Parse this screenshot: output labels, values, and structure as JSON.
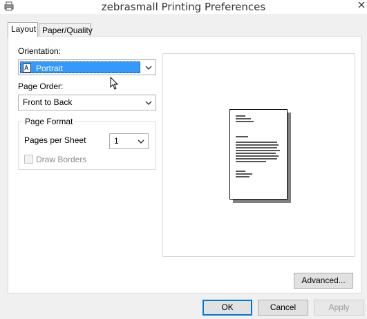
{
  "window": {
    "title": "zebrasmall Printing Preferences"
  },
  "tabs": [
    {
      "label": "Layout",
      "active": true
    },
    {
      "label": "Paper/Quality",
      "active": false
    }
  ],
  "layout": {
    "orientation": {
      "label": "Orientation:",
      "value": "Portrait",
      "icon": "portrait-page-icon"
    },
    "page_order": {
      "label": "Page Order:",
      "value": "Front to Back"
    },
    "page_format": {
      "legend": "Page Format",
      "pages_per_sheet": {
        "label": "Pages per Sheet",
        "value": "1"
      },
      "draw_borders": {
        "label": "Draw Borders",
        "checked": false,
        "enabled": false
      }
    },
    "advanced_label": "Advanced..."
  },
  "footer": {
    "ok_label": "OK",
    "cancel_label": "Cancel",
    "apply_label": "Apply",
    "apply_enabled": false
  },
  "colors": {
    "selection": "#3399ff",
    "default_button_border": "#0078d7"
  }
}
